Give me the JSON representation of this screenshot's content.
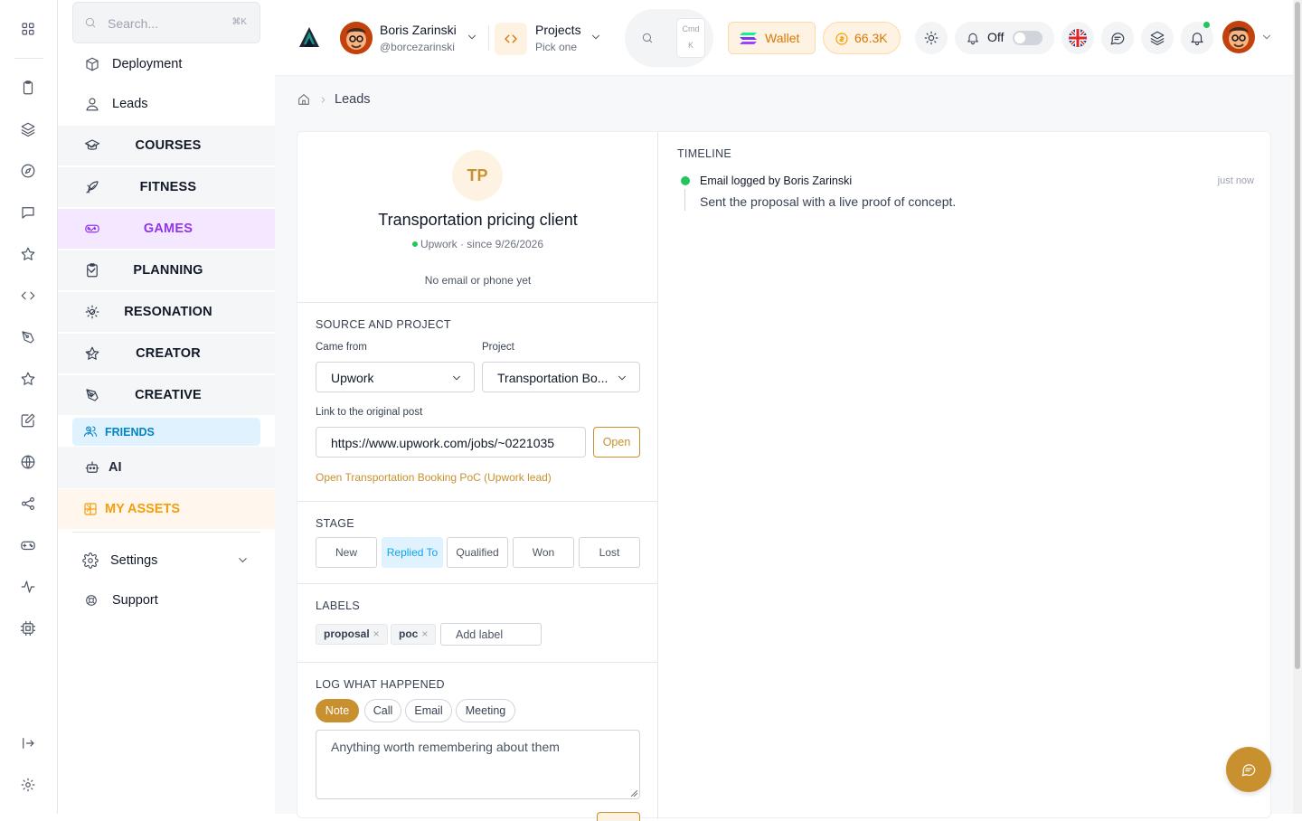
{
  "sidebar": {
    "search_placeholder": "Search...",
    "search_shortcut": "⌘K",
    "top_items": [
      {
        "label": "Deployment",
        "icon": "box-icon"
      },
      {
        "label": "Leads",
        "icon": "user-icon"
      }
    ],
    "groups": [
      {
        "label": "COURSES",
        "icon": "graduation-icon",
        "active": false
      },
      {
        "label": "FITNESS",
        "icon": "feather-icon",
        "active": false
      },
      {
        "label": "GAMES",
        "icon": "gamepad-icon",
        "active": true
      },
      {
        "label": "PLANNING",
        "icon": "clipboard-check-icon",
        "active": false
      },
      {
        "label": "RESONATION",
        "icon": "sun-icon",
        "active": false
      },
      {
        "label": "CREATOR",
        "icon": "star-icon",
        "active": false
      },
      {
        "label": "CREATIVE",
        "icon": "pen-tool-icon",
        "active": false
      }
    ],
    "friends_label": "FRIENDS",
    "ai_label": "AI",
    "assets_label": "MY ASSETS",
    "settings_label": "Settings",
    "support_label": "Support"
  },
  "header": {
    "user_name": "Boris Zarinski",
    "user_handle": "@borcezarinski",
    "projects_label": "Projects",
    "projects_sub": "Pick one",
    "search_kbd_1": "Cmd",
    "search_kbd_2": "K",
    "wallet_label": "Wallet",
    "coins_value": "66.3K",
    "toggle_label": "Off"
  },
  "breadcrumb": {
    "current": "Leads"
  },
  "lead": {
    "initials": "TP",
    "title": "Transportation pricing client",
    "source_since": "Upwork · since 9/26/2026",
    "contact_note": "No email or phone yet",
    "source_section_title": "SOURCE AND PROJECT",
    "came_from_label": "Came from",
    "came_from_value": "Upwork",
    "project_label": "Project",
    "project_value": "Transportation Bo...",
    "link_label": "Link to the original post",
    "link_value": "https://www.upwork.com/jobs/~0221035",
    "open_button": "Open",
    "open_link_text": "Open Transportation Booking PoC (Upwork lead)",
    "stage_title": "STAGE",
    "stages": [
      "New",
      "Replied To",
      "Qualified",
      "Won",
      "Lost"
    ],
    "selected_stage": "Replied To",
    "labels_title": "LABELS",
    "labels": [
      "proposal",
      "poc"
    ],
    "add_label_placeholder": "Add label",
    "log_title": "LOG WHAT HAPPENED",
    "log_types": [
      "Note",
      "Call",
      "Email",
      "Meeting"
    ],
    "selected_log_type": "Note",
    "log_placeholder": "Anything worth remembering about them"
  },
  "timeline": {
    "title": "TIMELINE",
    "entries": [
      {
        "heading": "Email logged by Boris Zarinski",
        "time": "just now",
        "body": "Sent the proposal with a live proof of concept."
      }
    ]
  },
  "colors": {
    "accent_gold": "#c9902f",
    "games_purple": "#9333ea",
    "friends_blue": "#0284c7",
    "assets_orange": "#f59e0b",
    "status_green": "#22c55e"
  }
}
